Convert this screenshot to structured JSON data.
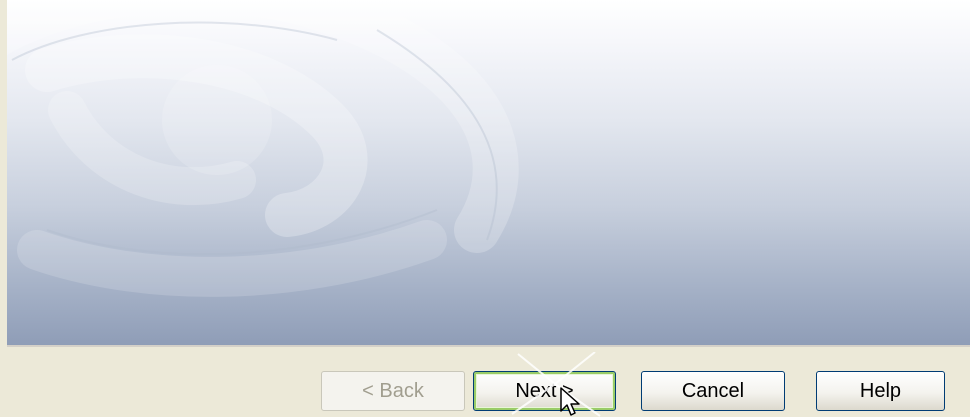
{
  "wizard": {
    "banner": {
      "watermark": "swirl-watermark"
    },
    "buttons": {
      "back_label": "< Back",
      "next_label": "Next >",
      "cancel_label": "Cancel",
      "help_label": "Help"
    },
    "state": {
      "back_enabled": false,
      "default_button": "next"
    }
  },
  "colors": {
    "face": "#ece9d8",
    "banner_top": "#ffffff",
    "banner_bottom": "#8f9db7",
    "button_border": "#003c74",
    "default_glow": "#9acc68",
    "disabled_text": "#a19e8f"
  },
  "icons": {
    "pointer": "mouse-pointer-icon"
  }
}
